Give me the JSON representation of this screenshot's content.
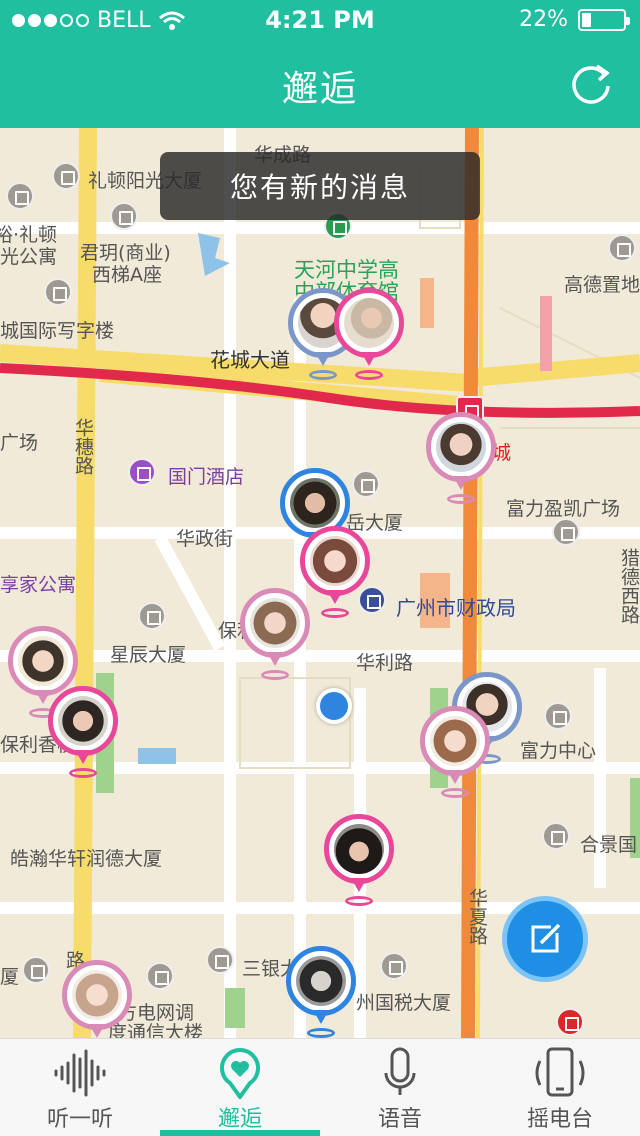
{
  "status": {
    "carrier": "BELL",
    "time": "4:21 PM",
    "battery": "22%",
    "battery_level": 0.22,
    "signal_dots_filled": 3,
    "signal_dots_total": 5
  },
  "nav": {
    "title": "邂逅",
    "refresh_icon": "refresh-icon"
  },
  "toast": "您有新的消息",
  "map": {
    "labels": {
      "huacheng_road": "华成路",
      "liton_yangguang": "礼顿阳光大厦",
      "yu_liton": "裕·礼顿",
      "guang_gongyu": "光公寓",
      "junyue": "君玥(商业)",
      "xiti_a": "西梯A座",
      "tianhe_school": "天河中学高",
      "tianhe_school2": "中部体育馆",
      "gaode": "高德置地",
      "chengguoji": "城国际写字楼",
      "huacheng_avenue": "花城大道",
      "guangchang": "广场",
      "huasui_road": "华穗路",
      "guomen_hotel": "国门酒店",
      "cheng": "城",
      "fuli_yingbin": "富力盈凯广场",
      "yue_building": "岳大厦",
      "huazheng_street": "华政街",
      "xiangjia": "享家公寓",
      "baoli": "保利",
      "guangzhou_finance": "广州市财政局",
      "xingchen": "星辰大厦",
      "huali_road": "华利路",
      "lixiangge": "保利香槟",
      "fuli_center": "富力中心",
      "haohan": "皓瀚华轩润德大厦",
      "hejing": "合景国",
      "huaxia_road": "华夏路",
      "sanyin": "三银大",
      "guoshui": "州国税大厦",
      "dianwang": "方电网调",
      "tongxin": "度通信大楼",
      "sha": "厦",
      "lu": "路",
      "liancheng": "猎德西路"
    }
  },
  "tabs": [
    {
      "label": "听一听",
      "icon": "soundwave-icon"
    },
    {
      "label": "邂逅",
      "icon": "heart-pin-icon"
    },
    {
      "label": "语音",
      "icon": "microphone-icon"
    },
    {
      "label": "摇电台",
      "icon": "phone-shake-icon"
    }
  ],
  "colors": {
    "brand": "#1fbf9f",
    "pin_pink": "#e9479a",
    "pin_blue": "#2f84e0",
    "fab": "#1f8fe6"
  }
}
